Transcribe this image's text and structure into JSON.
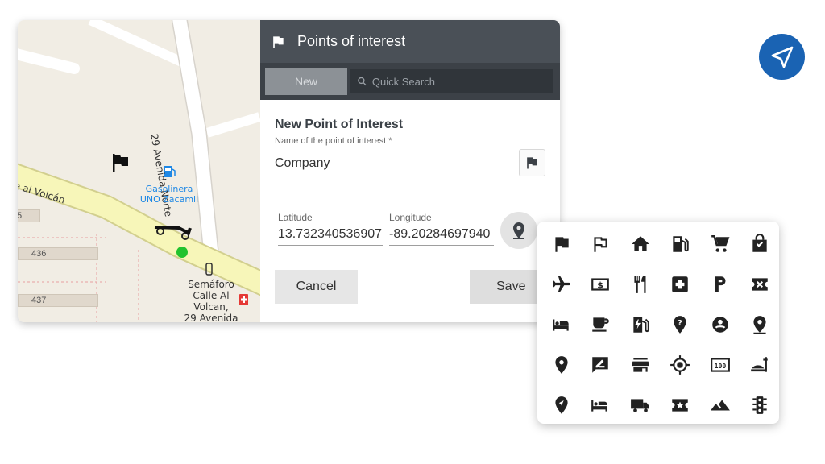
{
  "panel": {
    "title": "Points of interest",
    "new_button": "New",
    "search_placeholder": "Quick Search"
  },
  "form": {
    "title": "New Point of Interest",
    "name_label": "Name of the point of interest *",
    "name_value": "Company",
    "latitude_label": "Latitude",
    "latitude_value": "13.732340536907",
    "longitude_label": "Longitude",
    "longitude_value": "-89.20284697940",
    "cancel_label": "Cancel",
    "save_label": "Save"
  },
  "map": {
    "street_avenida": "29 Avenida Norte",
    "street_volcan": "e al Volcán",
    "poi_gas_line1": "Gasolinera",
    "poi_gas_line2": "UNO Zacamil",
    "lot_5": "5",
    "lot_436": "436",
    "lot_437": "437",
    "junction_line1": "Semáforo",
    "junction_line2": "Calle Al",
    "junction_line3": "Volcan,",
    "junction_line4": "29 Avenida"
  },
  "colors": {
    "header_bg": "#4a5057",
    "toolbar_bg": "#3c4147",
    "accent_blue": "#1a63b3",
    "vehicle_dot": "#22c32e",
    "poi_blue": "#1e88e5"
  },
  "icon_palette": [
    "flag-icon",
    "flag-outline-icon",
    "home-icon",
    "gas-station-icon",
    "shopping-cart-icon",
    "shopping-bag-icon",
    "airplane-icon",
    "money-icon",
    "restaurant-icon",
    "hospital-icon",
    "parking-icon",
    "ticket-icon",
    "hotel-icon",
    "coffee-icon",
    "ev-station-icon",
    "help-pin-icon",
    "person-pin-icon",
    "place-outline-icon",
    "location-pin-icon",
    "rate-review-icon",
    "store-icon",
    "crosshair-icon",
    "speed-counter-icon",
    "room-service-icon",
    "navigation-pin-icon",
    "bed-icon",
    "truck-icon",
    "local-play-icon",
    "terrain-icon",
    "traffic-light-icon"
  ]
}
